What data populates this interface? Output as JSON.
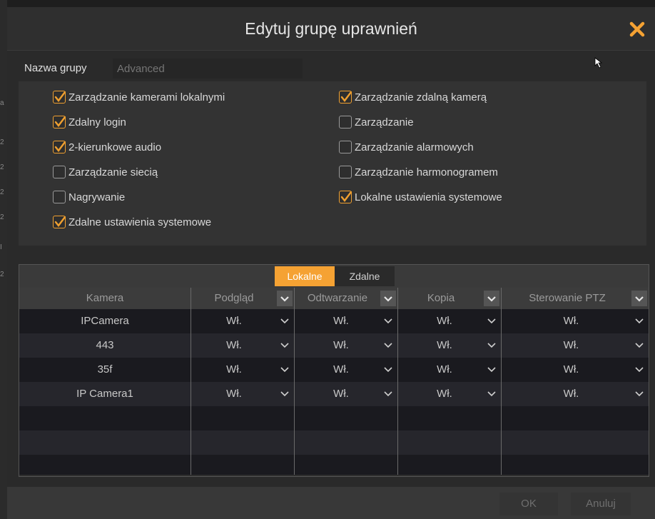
{
  "dialog": {
    "title": "Edytuj grupę uprawnień",
    "close_icon": "close-icon",
    "accent_color": "#f5a233"
  },
  "group_name": {
    "label": "Nazwa grupy",
    "value": "",
    "placeholder": "Advanced"
  },
  "permissions": {
    "left": [
      {
        "label": "Zarządzanie kamerami lokalnymi",
        "checked": true
      },
      {
        "label": "Zdalny login",
        "checked": true
      },
      {
        "label": "2-kierunkowe audio",
        "checked": true
      },
      {
        "label": "Zarządzanie siecią",
        "checked": false
      },
      {
        "label": "Nagrywanie",
        "checked": false
      },
      {
        "label": "Zdalne ustawienia systemowe",
        "checked": true
      }
    ],
    "right": [
      {
        "label": "Zarządzanie zdalną kamerą",
        "checked": true
      },
      {
        "label": "Zarządzanie",
        "checked": false
      },
      {
        "label": "Zarządzanie alarmowych",
        "checked": false
      },
      {
        "label": "Zarządzanie harmonogramem",
        "checked": false
      },
      {
        "label": "Lokalne ustawienia systemowe",
        "checked": true
      }
    ]
  },
  "tabs": [
    {
      "label": "Lokalne",
      "active": true
    },
    {
      "label": "Zdalne",
      "active": false
    }
  ],
  "table": {
    "headers": [
      "Kamera",
      "Podgląd",
      "Odtwarzanie",
      "Kopia",
      "Sterowanie PTZ"
    ],
    "rows": [
      [
        "IPCamera",
        "Wł.",
        "Wł.",
        "Wł.",
        "Wł."
      ],
      [
        "443",
        "Wł.",
        "Wł.",
        "Wł.",
        "Wł."
      ],
      [
        "35f",
        "Wł.",
        "Wł.",
        "Wł.",
        "Wł."
      ],
      [
        "IP Camera1",
        "Wł.",
        "Wł.",
        "Wł.",
        "Wł."
      ]
    ]
  },
  "buttons": {
    "ok": "OK",
    "cancel": "Anuluj"
  }
}
